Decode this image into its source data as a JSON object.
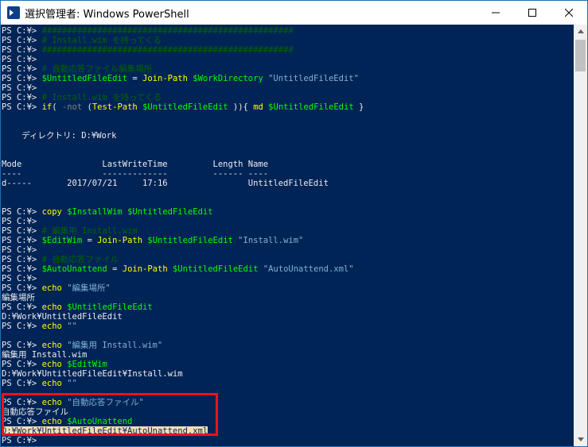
{
  "window": {
    "title": "選択管理者: Windows PowerShell",
    "minimize_icon": "minimize-icon",
    "maximize_icon": "maximize-icon",
    "close_icon": "close-icon"
  },
  "console": {
    "lines": [
      "PS C:¥> ##################################################",
      "PS C:¥> # Install.wim を持ってくる",
      "PS C:¥> ##################################################",
      "PS C:¥>",
      "PS C:¥> # 自動応答ファイル編集場所",
      "PS C:¥> $UntitledFileEdit = Join-Path $WorkDirectory \"UntitledFileEdit\"",
      "PS C:¥>",
      "PS C:¥> # Install.wim を持ってくる",
      "PS C:¥> if( -not (Test-Path $UntitledFileEdit )){ md $UntitledFileEdit }",
      "",
      "",
      "    ディレクトリ: D:¥Work",
      "",
      "",
      "Mode                LastWriteTime         Length Name",
      "----                -------------         ------ ----",
      "d-----       2017/07/21     17:16                UntitledFileEdit",
      "",
      "",
      "PS C:¥> copy $InstallWim $UntitledFileEdit",
      "PS C:¥>",
      "PS C:¥> # 編集用 Install.wim",
      "PS C:¥> $EditWim = Join-Path $UntitledFileEdit \"Install.wim\"",
      "PS C:¥>",
      "PS C:¥> # 自動応答ファイル",
      "PS C:¥> $AutoUnattend = Join-Path $UntitledFileEdit \"AutoUnattend.xml\"",
      "PS C:¥>",
      "PS C:¥> echo \"編集場所\"",
      "編集場所",
      "PS C:¥> echo $UntitledFileEdit",
      "D:¥Work¥UntitledFileEdit",
      "PS C:¥> echo \"\"",
      "",
      "PS C:¥> echo \"編集用 Install.wim\"",
      "編集用 Install.wim",
      "PS C:¥> echo $EditWim",
      "D:¥Work¥UntitledFileEdit¥Install.wim",
      "PS C:¥> echo \"\"",
      "",
      "PS C:¥> echo \"自動応答ファイル\"",
      "自動応答ファイル",
      "PS C:¥> echo $AutoUnattend",
      "D:¥Work¥UntitledFileEdit¥AutoUnattend.xml",
      "PS C:¥>"
    ]
  },
  "colors": {
    "console_bg": "#012456",
    "highlight_box": "#e8151b",
    "selection_bg": "#f5deb3"
  }
}
